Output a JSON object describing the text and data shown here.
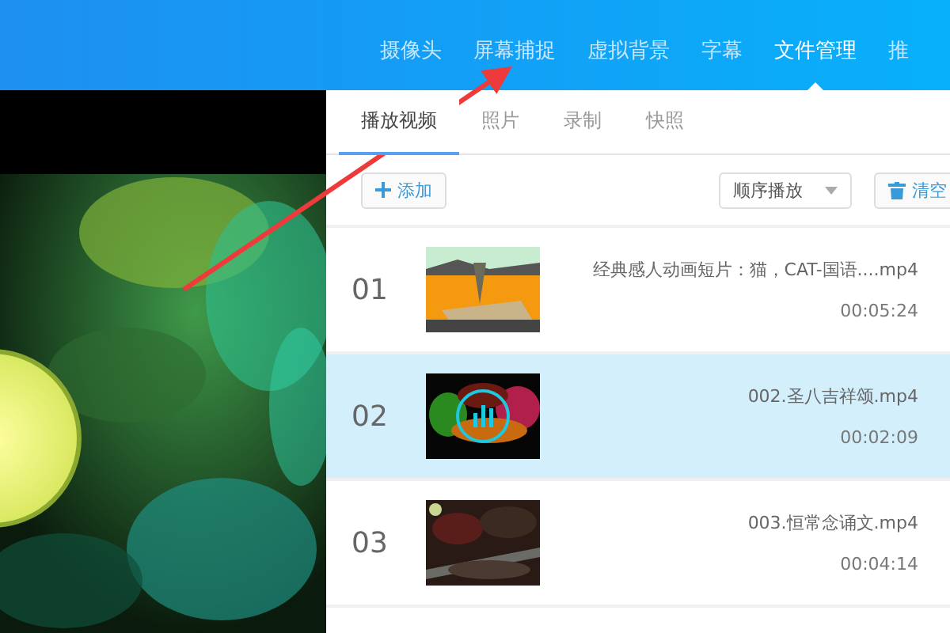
{
  "nav_tabs": [
    {
      "label": "摄像头",
      "selected": false
    },
    {
      "label": "屏幕捕捉",
      "selected": false
    },
    {
      "label": "虚拟背景",
      "selected": false
    },
    {
      "label": "字幕",
      "selected": false
    },
    {
      "label": "文件管理",
      "selected": true
    },
    {
      "label": "推",
      "selected": false
    }
  ],
  "sub_tabs": [
    {
      "label": "播放视频",
      "selected": true
    },
    {
      "label": "照片",
      "selected": false
    },
    {
      "label": "录制",
      "selected": false
    },
    {
      "label": "快照",
      "selected": false
    }
  ],
  "toolbar": {
    "add_button": "添加",
    "play_order": "顺序播放",
    "clear_button": "清空"
  },
  "files": [
    {
      "number": "01",
      "title": "经典感人动画短片：猫，CAT-国语....mp4",
      "duration": "00:05:24",
      "selected": false,
      "playing": false
    },
    {
      "number": "02",
      "title": "002.圣八吉祥颂.mp4",
      "duration": "00:02:09",
      "selected": true,
      "playing": true
    },
    {
      "number": "03",
      "title": "003.恒常念诵文.mp4",
      "duration": "00:04:14",
      "selected": false,
      "playing": false
    }
  ]
}
